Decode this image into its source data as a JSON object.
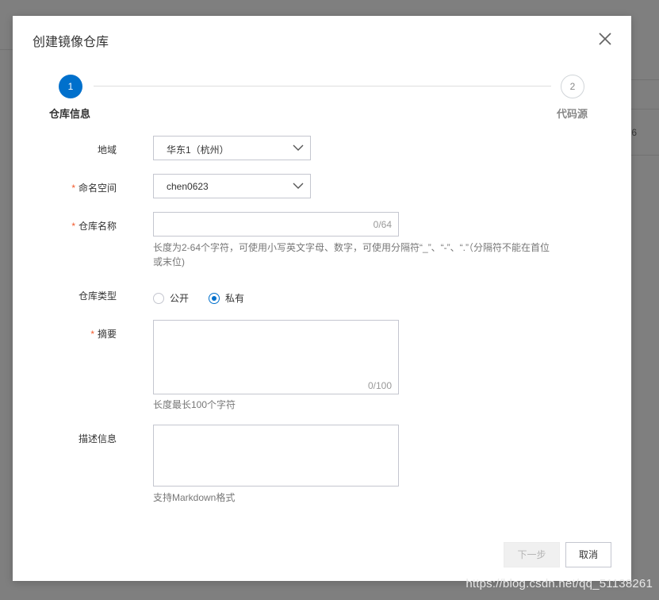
{
  "dialog": {
    "title": "创建镜像仓库",
    "close_icon": "close-icon"
  },
  "steps": [
    {
      "number": "1",
      "label": "仓库信息",
      "status": "active"
    },
    {
      "number": "2",
      "label": "代码源",
      "status": "pending"
    }
  ],
  "form": {
    "region": {
      "label": "地域",
      "value": "华东1（杭州）"
    },
    "namespace": {
      "required_mark": "*",
      "label": "命名空间",
      "value": "chen0623"
    },
    "repo_name": {
      "required_mark": "*",
      "label": "仓库名称",
      "value": "",
      "counter": "0/64",
      "help_line1": "长度为2-64个字符，可使用小写英文字母、数字，可使用分隔符“_”、“-”、“.”（分隔符不能在首位",
      "help_line2": "或末位)"
    },
    "repo_type": {
      "label": "仓库类型",
      "options": [
        {
          "label": "公开",
          "selected": false
        },
        {
          "label": "私有",
          "selected": true
        }
      ]
    },
    "summary": {
      "required_mark": "*",
      "label": "摘要",
      "value": "",
      "counter": "0/100",
      "help": "长度最长100个字符"
    },
    "description": {
      "label": "描述信息",
      "value": "",
      "help": "支持Markdown格式"
    }
  },
  "footer": {
    "next_label": "下一步",
    "cancel_label": "取消"
  },
  "background": {
    "partial_text": "6"
  },
  "watermark": "https://blog.csdn.net/qq_51138261",
  "colors": {
    "primary": "#0070cc",
    "required": "#f25a2c",
    "overlay": "#7f7f7f"
  }
}
